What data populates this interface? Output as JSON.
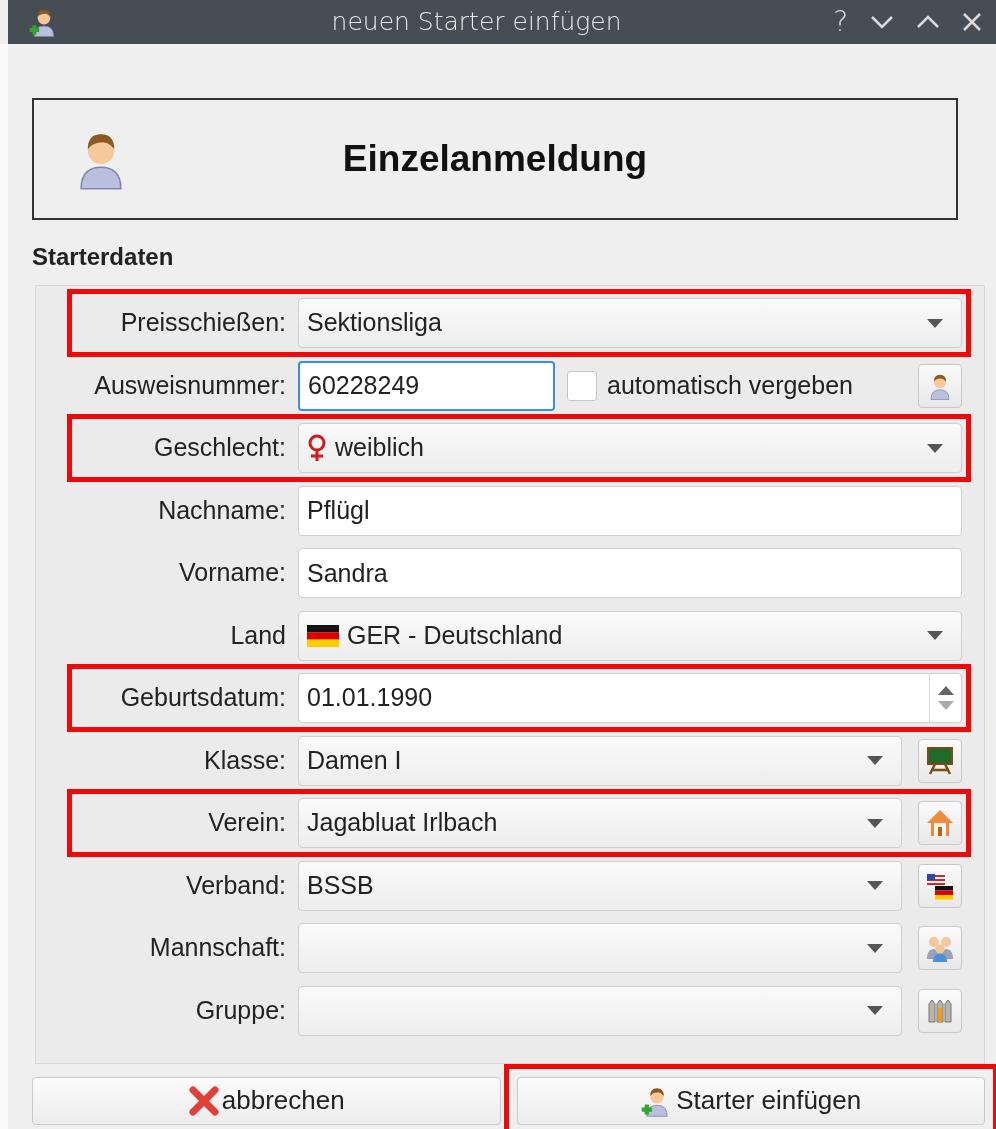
{
  "window": {
    "title": "neuen Starter einfügen",
    "help": "?"
  },
  "header": {
    "title": "Einzelanmeldung"
  },
  "section": {
    "title": "Starterdaten"
  },
  "rows": [
    {
      "label": "Preisschießen:",
      "kind": "select",
      "value": "Sektionsliga",
      "highlighted": true,
      "button": false
    },
    {
      "label": "Ausweisnummer:",
      "kind": "text",
      "value": "60228249",
      "focused": true,
      "checkbox": {
        "label": "automatisch vergeben",
        "checked": false
      },
      "highlighted": false,
      "button": true
    },
    {
      "label": "Geschlecht:",
      "kind": "select",
      "value": "weiblich",
      "highlighted": true,
      "button": false
    },
    {
      "label": "Nachname:",
      "kind": "text",
      "value": "Pflügl",
      "focused": false,
      "highlighted": false,
      "button": false
    },
    {
      "label": "Vorname:",
      "kind": "text",
      "value": "Sandra",
      "focused": false,
      "highlighted": false,
      "button": false
    },
    {
      "label": "Land",
      "kind": "select",
      "value": "GER - Deutschland",
      "highlighted": false,
      "button": false
    },
    {
      "label": "Geburtsdatum:",
      "kind": "spin",
      "value": "01.01.1990",
      "highlighted": true,
      "button": false
    },
    {
      "label": "Klasse:",
      "kind": "select",
      "value": "Damen I",
      "highlighted": false,
      "button": true
    },
    {
      "label": "Verein:",
      "kind": "select",
      "value": "Jagabluat Irlbach",
      "highlighted": true,
      "button": true
    },
    {
      "label": "Verband:",
      "kind": "select",
      "value": "BSSB",
      "highlighted": false,
      "button": true
    },
    {
      "label": "Mannschaft:",
      "kind": "select",
      "highlighted": false,
      "button": true
    },
    {
      "label": "Gruppe:",
      "kind": "select",
      "highlighted": false,
      "button": true
    }
  ],
  "buttons": [
    {
      "label": "abbrechen",
      "kind": "cancel",
      "highlighted": false
    },
    {
      "label": "Starter einfügen",
      "kind": "add",
      "highlighted": true
    }
  ]
}
